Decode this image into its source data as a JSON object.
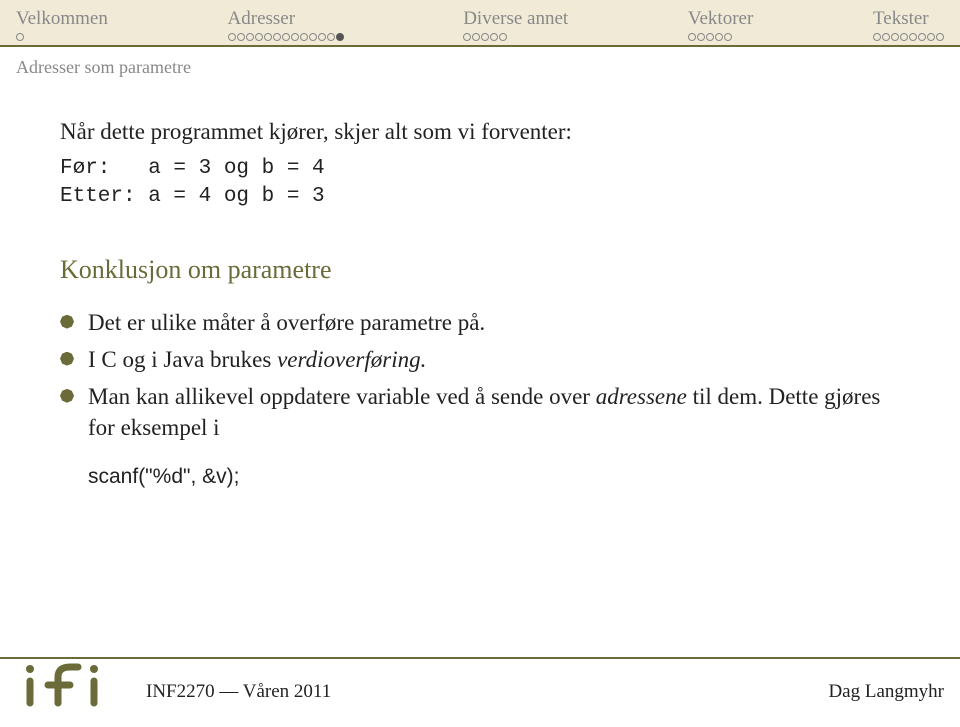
{
  "nav": {
    "items": [
      {
        "label": "Velkommen",
        "dots": 1,
        "active": -1
      },
      {
        "label": "Adresser",
        "dots": 13,
        "active": 12
      },
      {
        "label": "Diverse annet",
        "dots": 5,
        "active": -1
      },
      {
        "label": "Vektorer",
        "dots": 5,
        "active": -1
      },
      {
        "label": "Tekster",
        "dots": 8,
        "active": -1
      }
    ]
  },
  "subheader": "Adresser som parametre",
  "content": {
    "intro": "Når dette programmet kjører, skjer alt som vi forventer:",
    "codeline1": "Før:   a = 3 og b = 4",
    "codeline2": "Etter: a = 4 og b = 3",
    "section_title": "Konklusjon om parametre",
    "bullet1": "Det er ulike måter å overføre parametre på.",
    "bullet2a": "I C og i Java brukes ",
    "bullet2b": "verdioverføring.",
    "bullet3a": "Man kan allikevel oppdatere variable ved å sende over ",
    "bullet3b": "adressene",
    "bullet3c": " til dem. Dette gjøres for eksempel i",
    "code_inline": "scanf(\"%d\", &v);"
  },
  "footer": {
    "left": "INF2270 — Våren 2011",
    "right": "Dag Langmyhr"
  }
}
